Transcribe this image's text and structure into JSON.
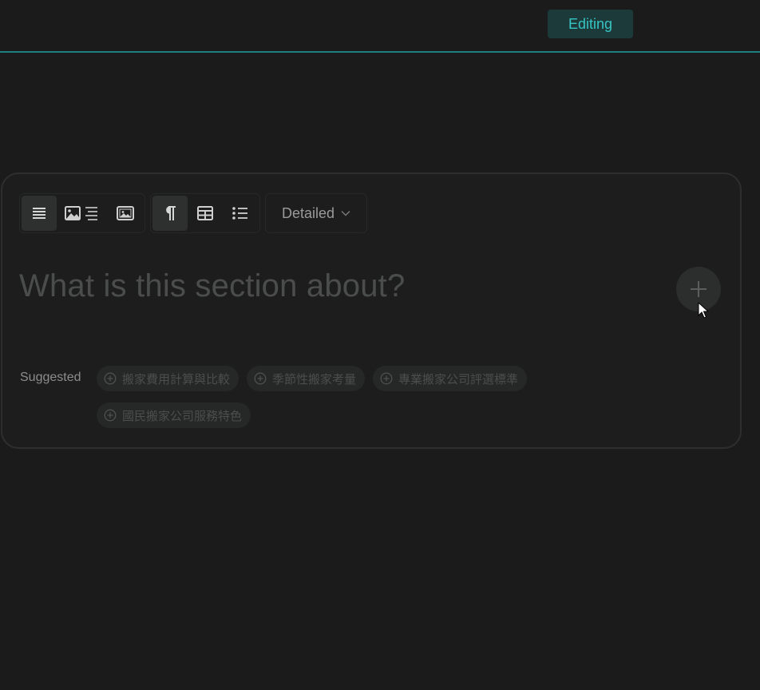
{
  "header": {
    "mode_badge": "Editing",
    "accent_color": "#1f7f80",
    "badge_text_color": "#37c4c4"
  },
  "toolbar": {
    "layout_buttons": [
      {
        "icon": "align-justify-icon",
        "active": true
      },
      {
        "icon": "image-left-text-icon",
        "active": false
      },
      {
        "icon": "image-full-icon",
        "active": false
      }
    ],
    "format_buttons": [
      {
        "icon": "paragraph-icon",
        "active": true
      },
      {
        "icon": "table-icon",
        "active": false
      },
      {
        "icon": "bullet-list-icon",
        "active": false
      }
    ],
    "length_dropdown": {
      "selected": "Detailed",
      "icon": "chevron-down-icon"
    }
  },
  "section": {
    "placeholder": "What is this section about?",
    "add_icon": "plus-icon"
  },
  "suggestions": {
    "label": "Suggested",
    "items": [
      "搬家費用計算與比較",
      "季節性搬家考量",
      "專業搬家公司評選標準",
      "國民搬家公司服務特色"
    ]
  }
}
